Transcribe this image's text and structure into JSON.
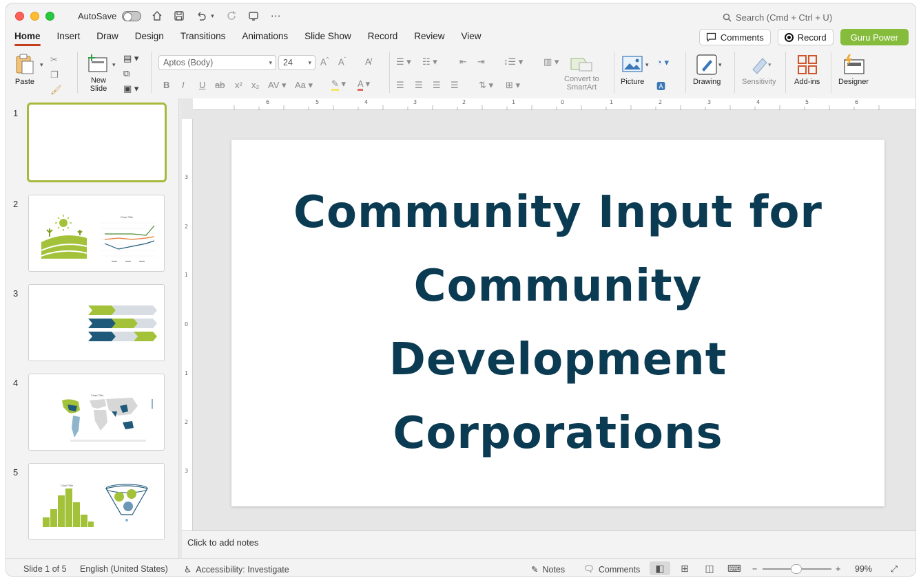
{
  "titlebar": {
    "autosave_label": "AutoSave",
    "search_placeholder": "Search (Cmd + Ctrl + U)"
  },
  "tabs": [
    "Home",
    "Insert",
    "Draw",
    "Design",
    "Transitions",
    "Animations",
    "Slide Show",
    "Record",
    "Review",
    "View"
  ],
  "tab_actions": {
    "comments": "Comments",
    "record": "Record",
    "guru": "Guru Power"
  },
  "ribbon": {
    "paste": "Paste",
    "new_slide_1": "New",
    "new_slide_2": "Slide",
    "font_name": "Aptos (Body)",
    "font_size": "24",
    "convert_1": "Convert to",
    "convert_2": "SmartArt",
    "picture": "Picture",
    "drawing": "Drawing",
    "sensitivity": "Sensitivity",
    "addins": "Add-ins",
    "designer": "Designer"
  },
  "thumbnails": [
    {
      "num": "1"
    },
    {
      "num": "2",
      "chart_title": "Chart Title"
    },
    {
      "num": "3"
    },
    {
      "num": "4",
      "chart_title": "Chart Title"
    },
    {
      "num": "5",
      "chart_title": "Chart Title"
    }
  ],
  "slide": {
    "title_lines": [
      "Community Input for",
      "Community",
      "Development",
      "Corporations"
    ]
  },
  "notes_placeholder": "Click to add notes",
  "ruler_h": [
    "6",
    "5",
    "4",
    "3",
    "2",
    "1",
    "0",
    "1",
    "2",
    "3",
    "4",
    "5",
    "6"
  ],
  "ruler_v": [
    "3",
    "2",
    "1",
    "0",
    "1",
    "2",
    "3"
  ],
  "status": {
    "slide_of": "Slide 1 of 5",
    "language": "English (United States)",
    "accessibility": "Accessibility: Investigate",
    "notes": "Notes",
    "comments": "Comments",
    "zoom": "99%"
  },
  "colors": {
    "accent_tab": "#c43e1c",
    "guru": "#86bc3c",
    "title": "#0b3b52",
    "thumb_selected": "#a7b83a"
  }
}
